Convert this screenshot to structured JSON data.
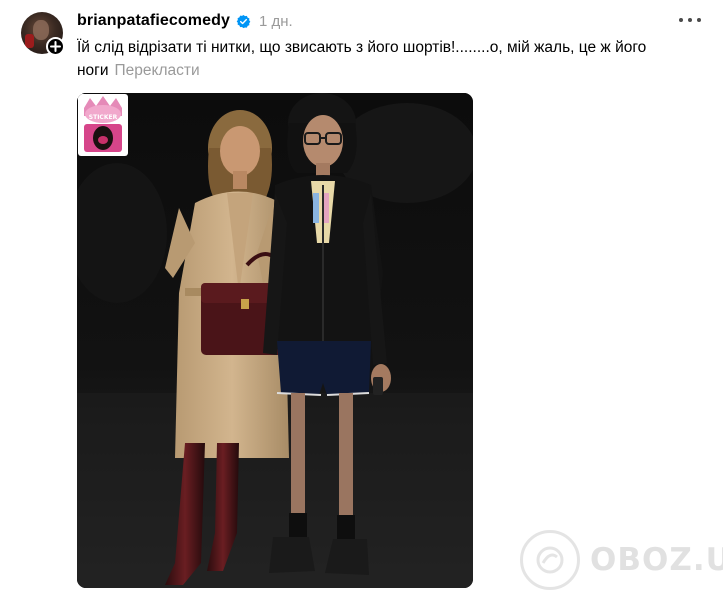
{
  "post": {
    "username": "brianpatafiecomedy",
    "verified": true,
    "time": "1 дн.",
    "caption": "Їй слід відрізати ті нитки, що звисають з його шортів!........о, мій жаль, це ж його ноги",
    "translate_label": "Перекласти"
  },
  "icons": {
    "avatar": "avatar",
    "follow": "plus-icon",
    "verified": "verified-badge-icon",
    "more": "more-options-icon"
  },
  "photo": {
    "description_tag": "photo-two-people-night",
    "sticker_name": "sticker"
  },
  "watermark": {
    "text": "OBOZ.UA"
  },
  "colors": {
    "verified": "#0095f6",
    "muted": "#9a9a9a",
    "text": "#000000"
  }
}
